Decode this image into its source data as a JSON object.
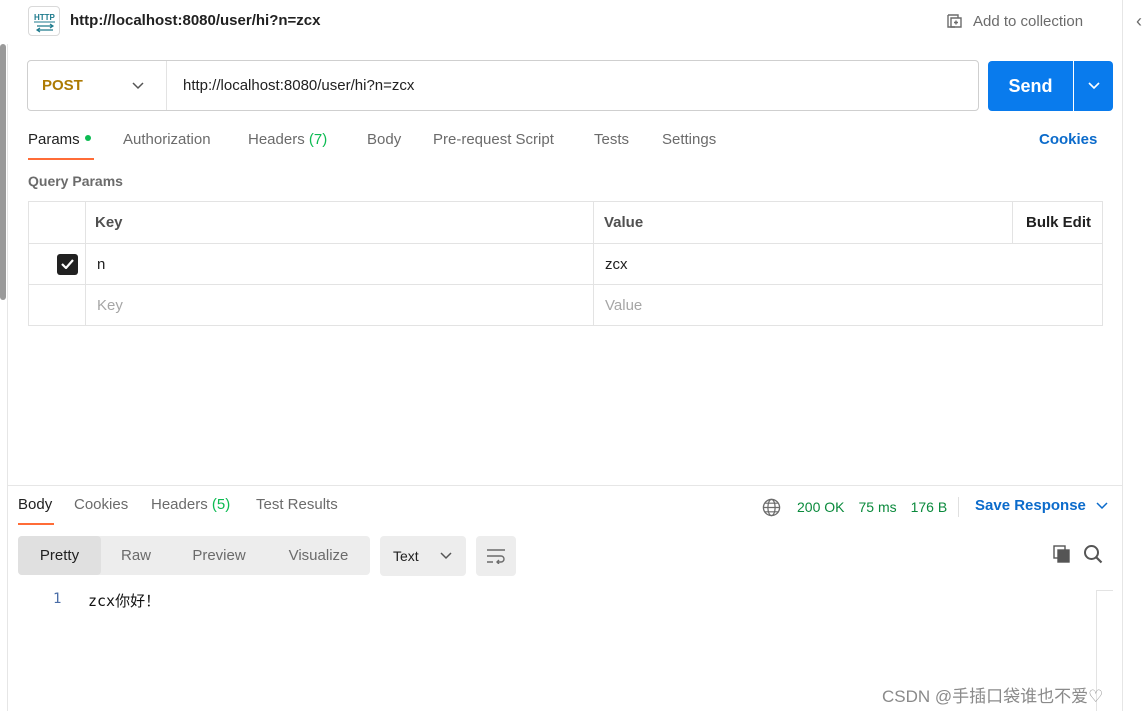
{
  "header": {
    "icon_label": "HTTP",
    "title": "http://localhost:8080/user/hi?n=zcx",
    "add_collection": "Add to collection"
  },
  "request": {
    "method": "POST",
    "url": "http://localhost:8080/user/hi?n=zcx",
    "send_label": "Send"
  },
  "tabs": {
    "params": "Params",
    "authorization": "Authorization",
    "headers": "Headers",
    "headers_count": "(7)",
    "body": "Body",
    "prerequest": "Pre-request Script",
    "tests": "Tests",
    "settings": "Settings",
    "cookies": "Cookies"
  },
  "query_params": {
    "title": "Query Params",
    "col_key": "Key",
    "col_value": "Value",
    "bulk_edit": "Bulk Edit",
    "rows": [
      {
        "checked": true,
        "key": "n",
        "value": "zcx"
      }
    ],
    "key_placeholder": "Key",
    "value_placeholder": "Value"
  },
  "response": {
    "tabs": {
      "body": "Body",
      "cookies": "Cookies",
      "headers": "Headers",
      "headers_count": "(5)",
      "test_results": "Test Results"
    },
    "status": "200 OK",
    "time": "75 ms",
    "size": "176 B",
    "save_response": "Save Response",
    "views": [
      "Pretty",
      "Raw",
      "Preview",
      "Visualize"
    ],
    "format": "Text",
    "lines": [
      {
        "num": "1",
        "text": "zcx你好！"
      }
    ]
  },
  "watermark": "CSDN @手插口袋谁也不爱♡",
  "colors": {
    "accent_orange": "#ff6c37",
    "send_blue": "#097bed",
    "link_blue": "#0b6bcb",
    "method_post": "#ad7a03",
    "status_green": "#0a8a3c"
  }
}
